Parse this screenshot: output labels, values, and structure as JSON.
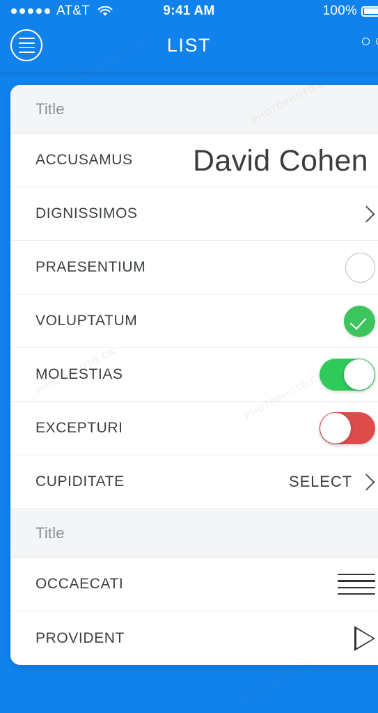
{
  "status_bar": {
    "carrier": "AT&T",
    "signal_dots": 5,
    "wifi_icon": "wifi-icon",
    "time": "9:41 AM",
    "battery_percent": "100%",
    "battery_icon": "battery-full-icon"
  },
  "nav_bar": {
    "title": "LIST",
    "menu_icon": "hamburger-circle-icon",
    "overflow_icon": "more-dots-icon",
    "background_color": "#1182ec"
  },
  "sections": [
    {
      "header": "Title",
      "rows": [
        {
          "label": "ACCUSAMUS",
          "accessory": "value-text",
          "value": "David Cohen"
        },
        {
          "label": "DIGNISSIMOS",
          "accessory": "chevron",
          "value": ""
        },
        {
          "label": "PRAESENTIUM",
          "accessory": "radio-circle",
          "value": ""
        },
        {
          "label": "VOLUPTATUM",
          "accessory": "check-circle",
          "value": ""
        },
        {
          "label": "MOLESTIAS",
          "accessory": "toggle-on",
          "value": ""
        },
        {
          "label": "EXCEPTURI",
          "accessory": "toggle-off",
          "value": ""
        },
        {
          "label": "CUPIDITATE",
          "accessory": "select-chevron",
          "value": "SELECT"
        }
      ]
    },
    {
      "header": "Title",
      "rows": [
        {
          "label": "OCCAECATI",
          "accessory": "reorder-handle",
          "value": ""
        },
        {
          "label": "PROVIDENT",
          "accessory": "play-triangle",
          "value": ""
        }
      ]
    }
  ],
  "colors": {
    "accent_blue": "#1182ec",
    "toggle_on_green": "#30ca5b",
    "toggle_off_red": "#dd4b4b",
    "check_green": "#3ec45e",
    "section_header_bg": "#f4f5f6",
    "label_text": "#3b3f42",
    "header_text": "#8d8f92"
  },
  "watermarks": [
    "PHOTOPHOTO.CN",
    "PHOTOPHOTO.CN",
    "PHOTOPHOTO.CN",
    "PHOTOPHOTO.CN",
    "PHOTOPHOTO.CN"
  ]
}
